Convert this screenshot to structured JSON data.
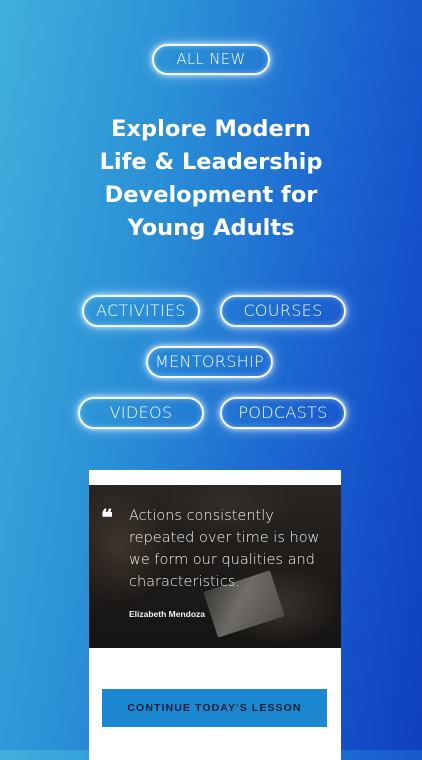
{
  "badge": {
    "label": "ALL NEW"
  },
  "headline": {
    "lines": [
      "Explore Modern",
      "Life & Leadership",
      "Development for",
      "Young Adults"
    ]
  },
  "categories": {
    "activities": "ACTIVITIES",
    "courses": "COURSES",
    "mentorship": "MENTORSHIP",
    "videos": "VIDEOS",
    "podcasts": "PODCASTS"
  },
  "card": {
    "quote_mark": "❝",
    "quote": "Actions consistently repeated over time is how we form our qualities and characteristics.",
    "author": "Elizabeth Mendoza",
    "cta_label": "CONTINUE TODAY'S LESSON"
  },
  "colors": {
    "gradient_start": "#3fb0dc",
    "gradient_end": "#0f3fc0",
    "cta_background": "#1d88d2",
    "glow": "#ffffff"
  }
}
